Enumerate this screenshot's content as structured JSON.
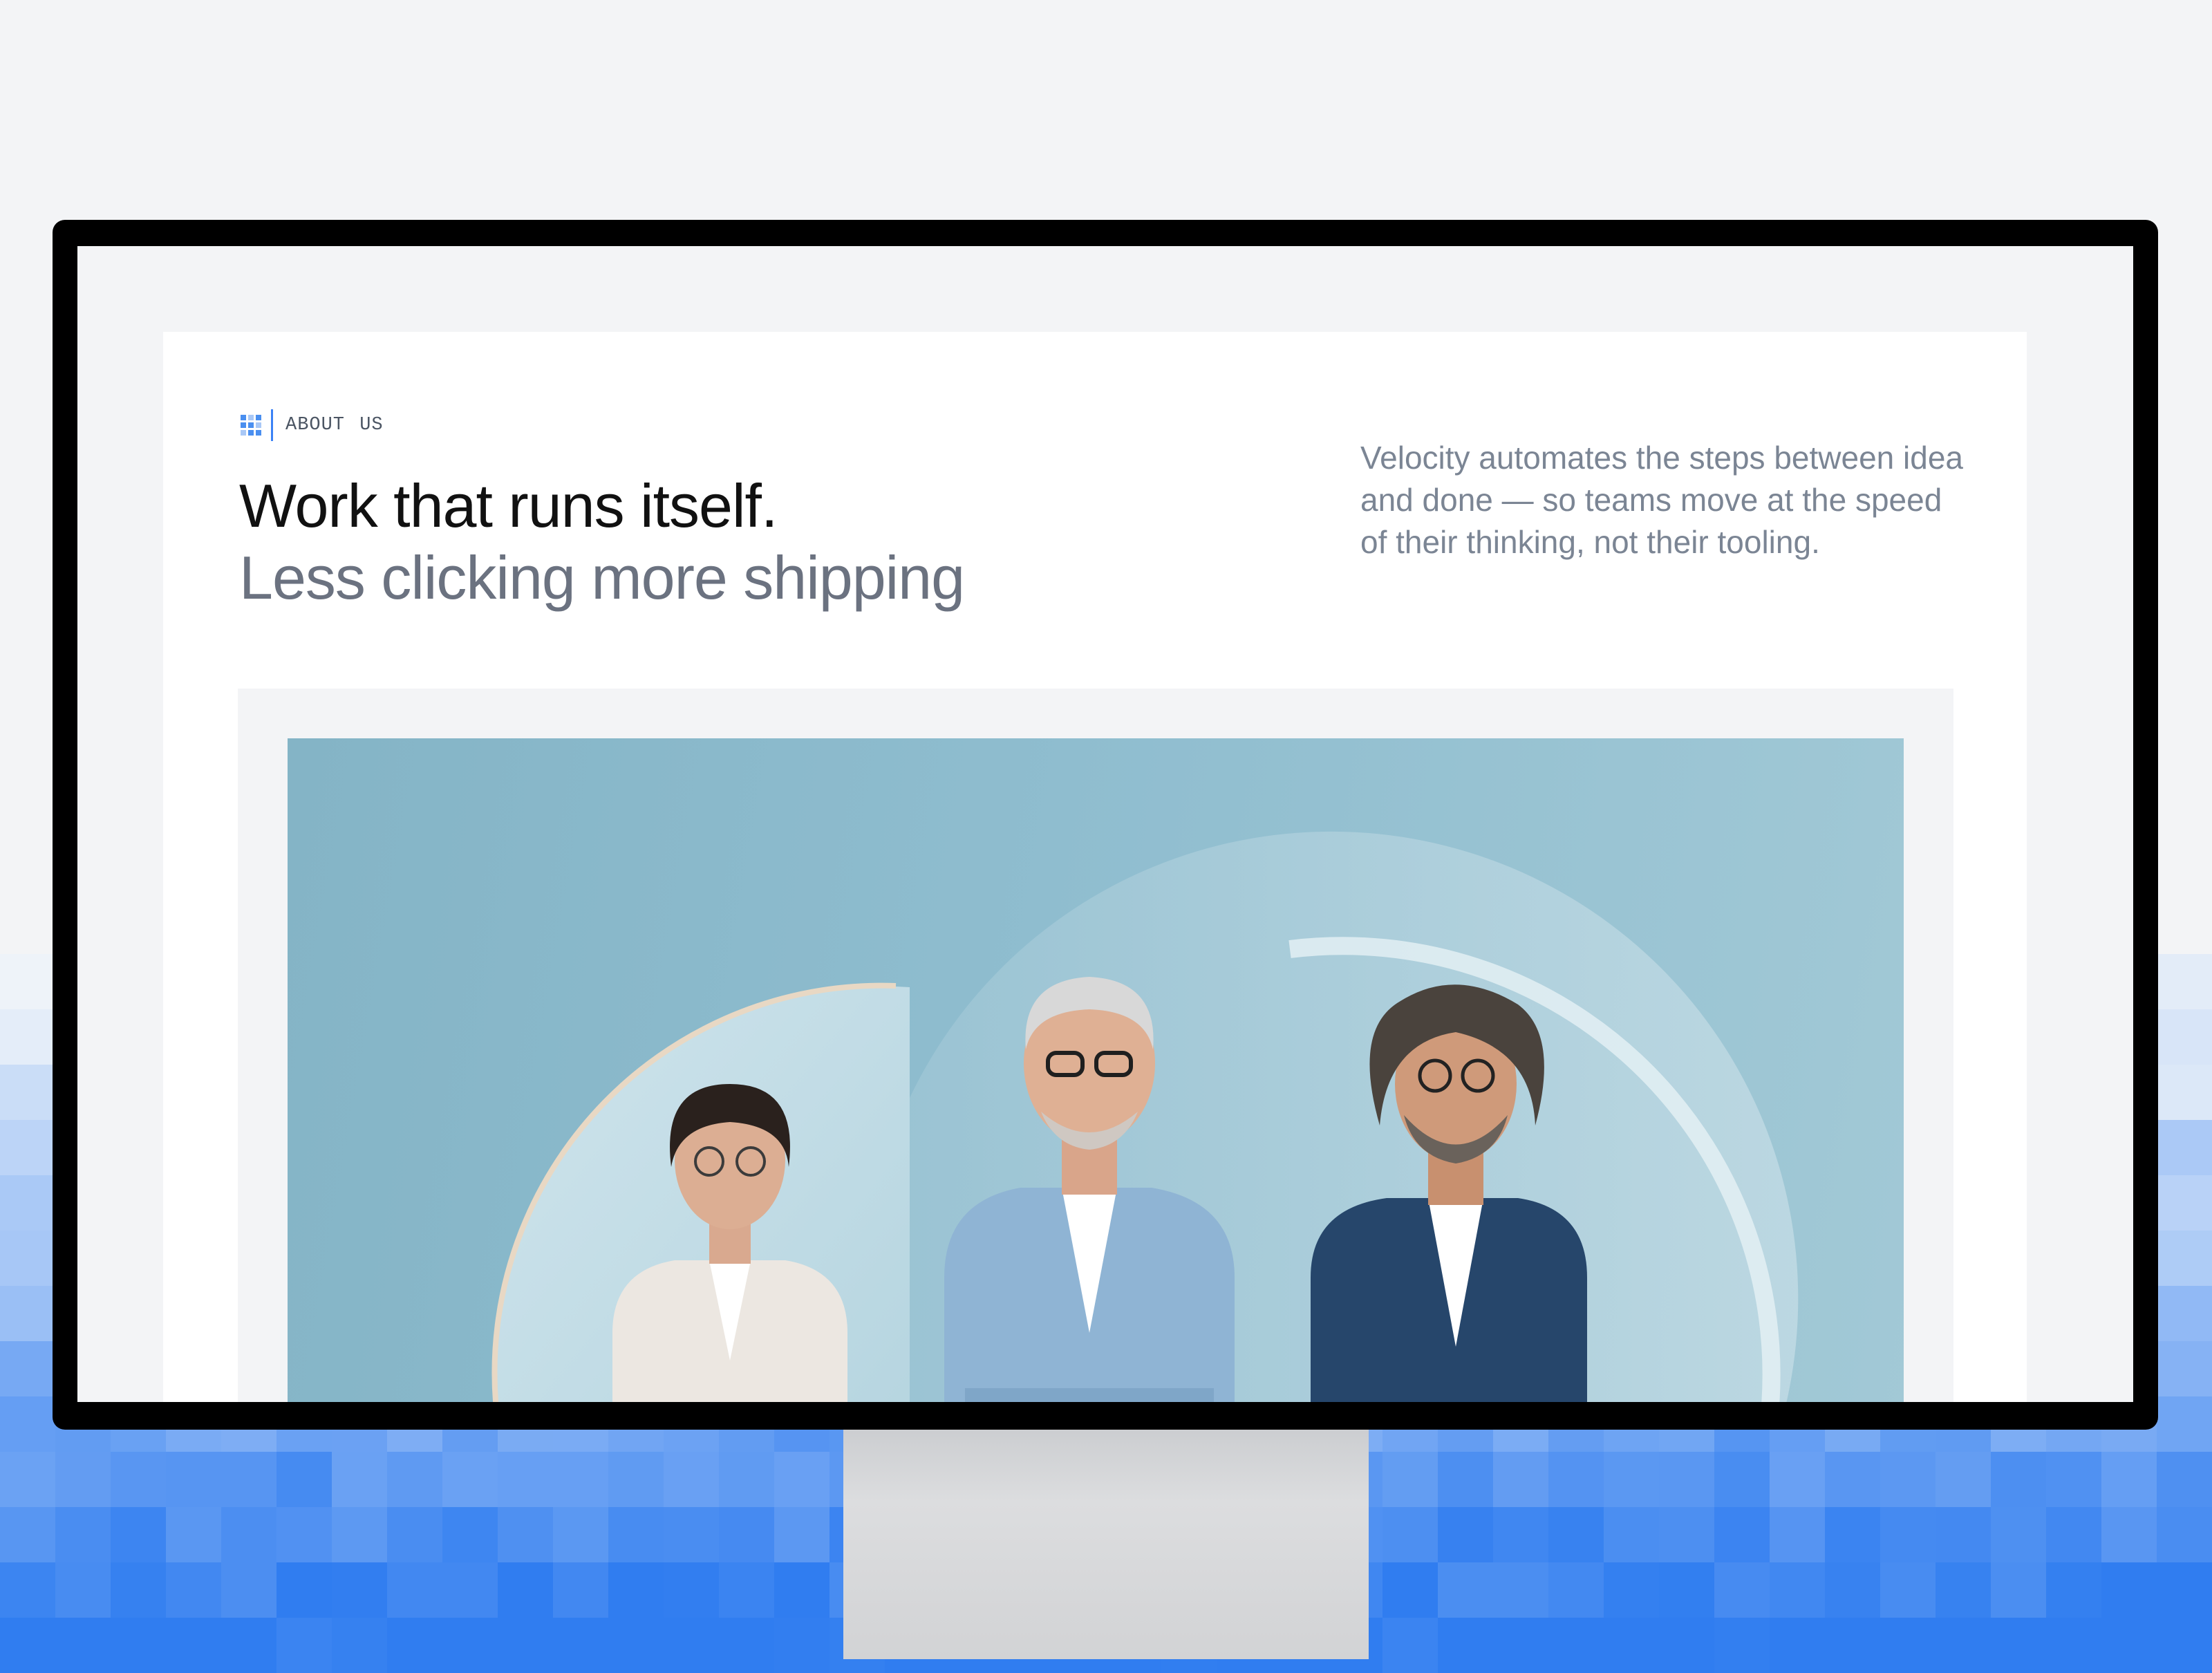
{
  "about": {
    "label": "ABOUT US",
    "icon": "grid-dots-icon"
  },
  "hero": {
    "headline": "Work that runs itself.",
    "subheadline": "Less clicking more shipping",
    "description": "Velocity automates the steps between idea and done — so teams move at the speed of their thinking, not their tooling."
  },
  "colors": {
    "accent": "#3b82f6",
    "heading": "#111111",
    "muted": "#6b7280",
    "photo_backdrop": "#8fbdcf"
  },
  "team_photo": {
    "people": [
      {
        "name": "person-woman-glasses"
      },
      {
        "name": "person-man-gray-hair"
      },
      {
        "name": "person-man-curly-hair"
      }
    ]
  }
}
